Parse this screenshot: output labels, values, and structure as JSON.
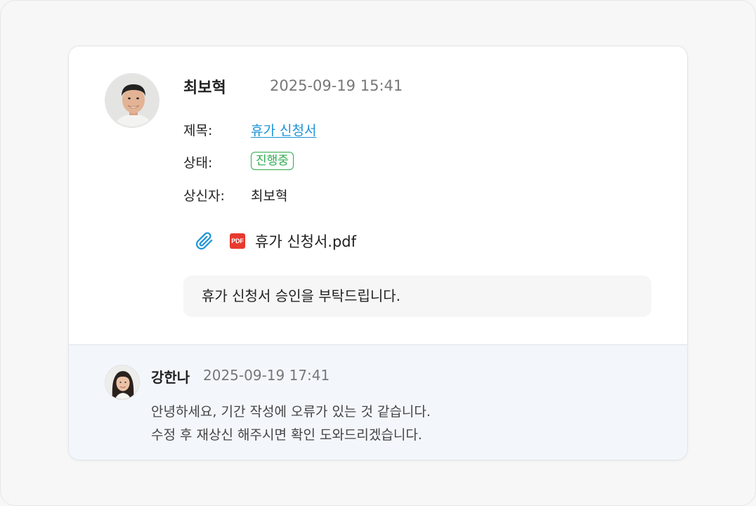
{
  "post": {
    "author": "최보혁",
    "timestamp": "2025-09-19 15:41",
    "fields": {
      "title_label": "제목:",
      "title_value": "휴가 신청서",
      "status_label": "상태:",
      "status_value": "진행중",
      "requester_label": "상신자:",
      "requester_value": "최보혁"
    },
    "attachment": {
      "icon": "paperclip-icon",
      "file_icon": "pdf-file-icon",
      "file_icon_text": "PDF",
      "file_name": "휴가 신청서.pdf"
    },
    "message": "휴가 신청서 승인을 부탁드립니다."
  },
  "comment": {
    "author": "강한나",
    "timestamp": "2025-09-19 17:41",
    "lines": [
      "안녕하세요, 기간 작성에 오류가 있는 것 같습니다.",
      "수정 후 재상신 해주시면 확인 도와드리겠습니다."
    ]
  },
  "colors": {
    "link": "#1a93d8",
    "status_green": "#2eaa4f",
    "pdf_red": "#e8392f",
    "comment_bg": "#f3f7fc"
  }
}
